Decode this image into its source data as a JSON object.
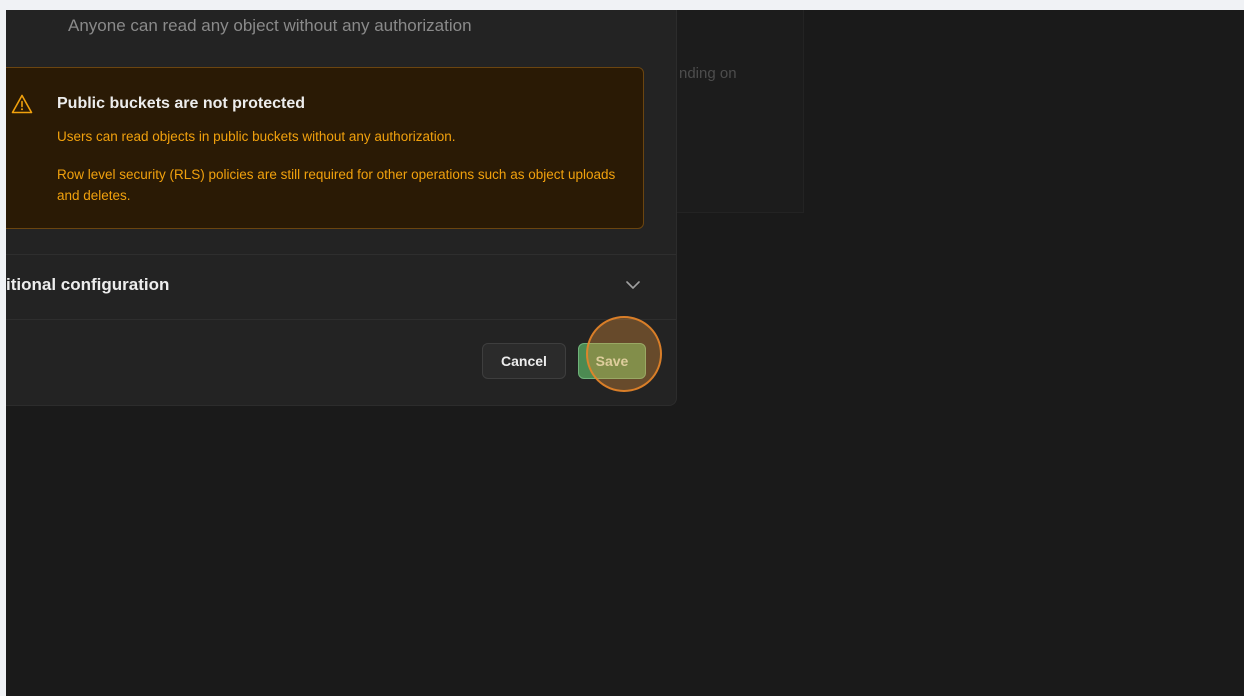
{
  "background": {
    "partial_text": "nding on"
  },
  "modal": {
    "description": "Anyone can read any object without any authorization",
    "alert": {
      "icon": "warning-triangle-icon",
      "title": "Public buckets are not protected",
      "line1": "Users can read objects in public buckets without any authorization.",
      "line2": "Row level security (RLS) policies are still required for other operations such as object uploads and deletes."
    },
    "additional_config": {
      "label": "itional configuration",
      "icon": "chevron-down-icon"
    },
    "footer": {
      "cancel_label": "Cancel",
      "save_label": "Save"
    }
  },
  "colors": {
    "alert_text": "#f1a10d",
    "alert_bg": "#2a1a05",
    "save_button": "#4c8a52",
    "click_indicator": "#e88c3a"
  }
}
